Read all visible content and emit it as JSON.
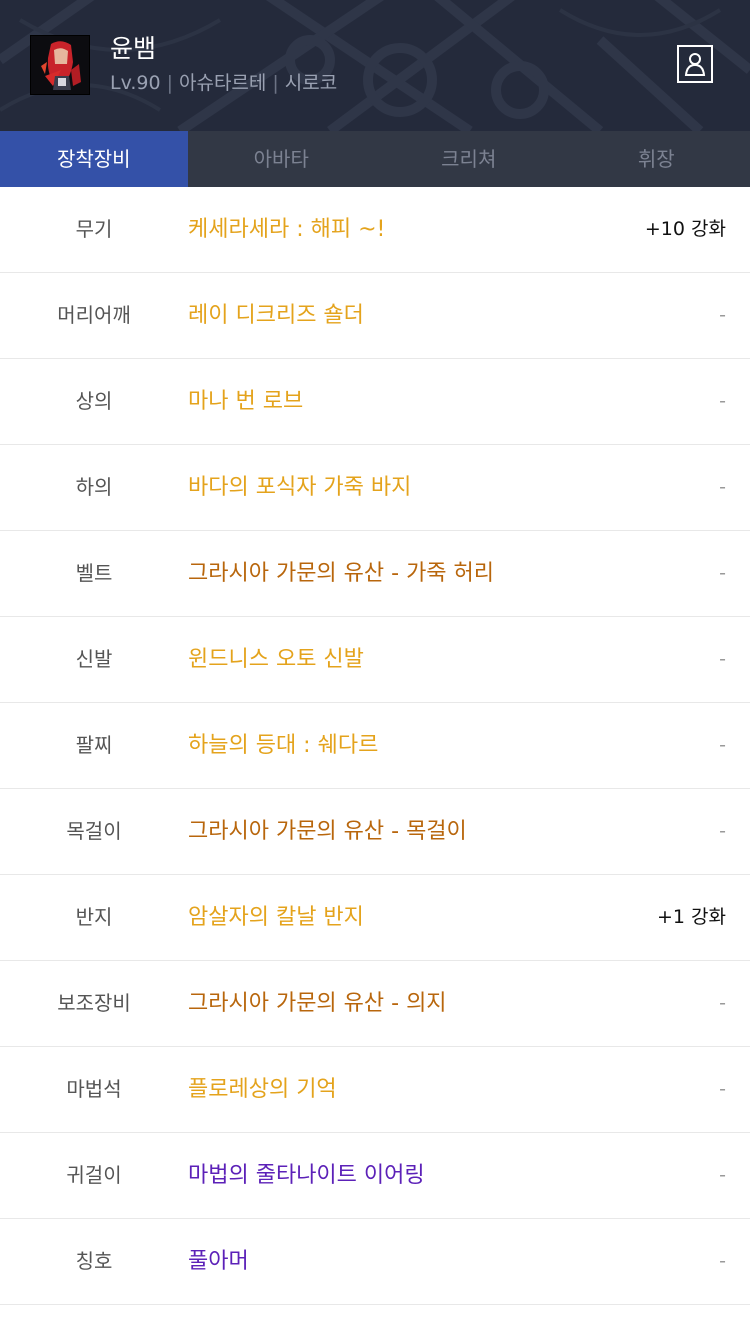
{
  "character": {
    "name": "윤뱀",
    "level": "Lv.90",
    "server": "아슈타르테",
    "job": "시로코",
    "separator": "|"
  },
  "icons": {
    "avatar": "character-portrait",
    "profile": "user-profile-icon"
  },
  "tabs": [
    {
      "label": "장착장비",
      "active": true
    },
    {
      "label": "아바타",
      "active": false
    },
    {
      "label": "크리쳐",
      "active": false
    },
    {
      "label": "휘장",
      "active": false
    }
  ],
  "colors": {
    "header_bg": "#242a3b",
    "tab_active": "#3451a8",
    "epic": "#e4a31c",
    "legendary": "#b8660c",
    "unique": "#5c21b8"
  },
  "equipment": [
    {
      "slot": "무기",
      "name": "케세라세라 : 해피 ~!",
      "color": "#e4a31c",
      "enhance": "+10 강화"
    },
    {
      "slot": "머리어깨",
      "name": "레이 디크리즈 숄더",
      "color": "#e4a31c",
      "enhance": "-"
    },
    {
      "slot": "상의",
      "name": "마나 번 로브",
      "color": "#e4a31c",
      "enhance": "-"
    },
    {
      "slot": "하의",
      "name": "바다의 포식자 가죽 바지",
      "color": "#e4a31c",
      "enhance": "-"
    },
    {
      "slot": "벨트",
      "name": "그라시아 가문의 유산 - 가죽 허리",
      "color": "#b8660c",
      "enhance": "-"
    },
    {
      "slot": "신발",
      "name": "윈드니스 오토 신발",
      "color": "#e4a31c",
      "enhance": "-"
    },
    {
      "slot": "팔찌",
      "name": "하늘의 등대 : 쉐다르",
      "color": "#e4a31c",
      "enhance": "-"
    },
    {
      "slot": "목걸이",
      "name": "그라시아 가문의 유산 - 목걸이",
      "color": "#b8660c",
      "enhance": "-"
    },
    {
      "slot": "반지",
      "name": "암살자의 칼날 반지",
      "color": "#e4a31c",
      "enhance": "+1 강화"
    },
    {
      "slot": "보조장비",
      "name": "그라시아 가문의 유산 - 의지",
      "color": "#b8660c",
      "enhance": "-"
    },
    {
      "slot": "마법석",
      "name": "플로레상의 기억",
      "color": "#e4a31c",
      "enhance": "-"
    },
    {
      "slot": "귀걸이",
      "name": "마법의 줄타나이트 이어링",
      "color": "#5c21b8",
      "enhance": "-"
    },
    {
      "slot": "칭호",
      "name": "풀아머",
      "color": "#5c21b8",
      "enhance": "-"
    }
  ]
}
